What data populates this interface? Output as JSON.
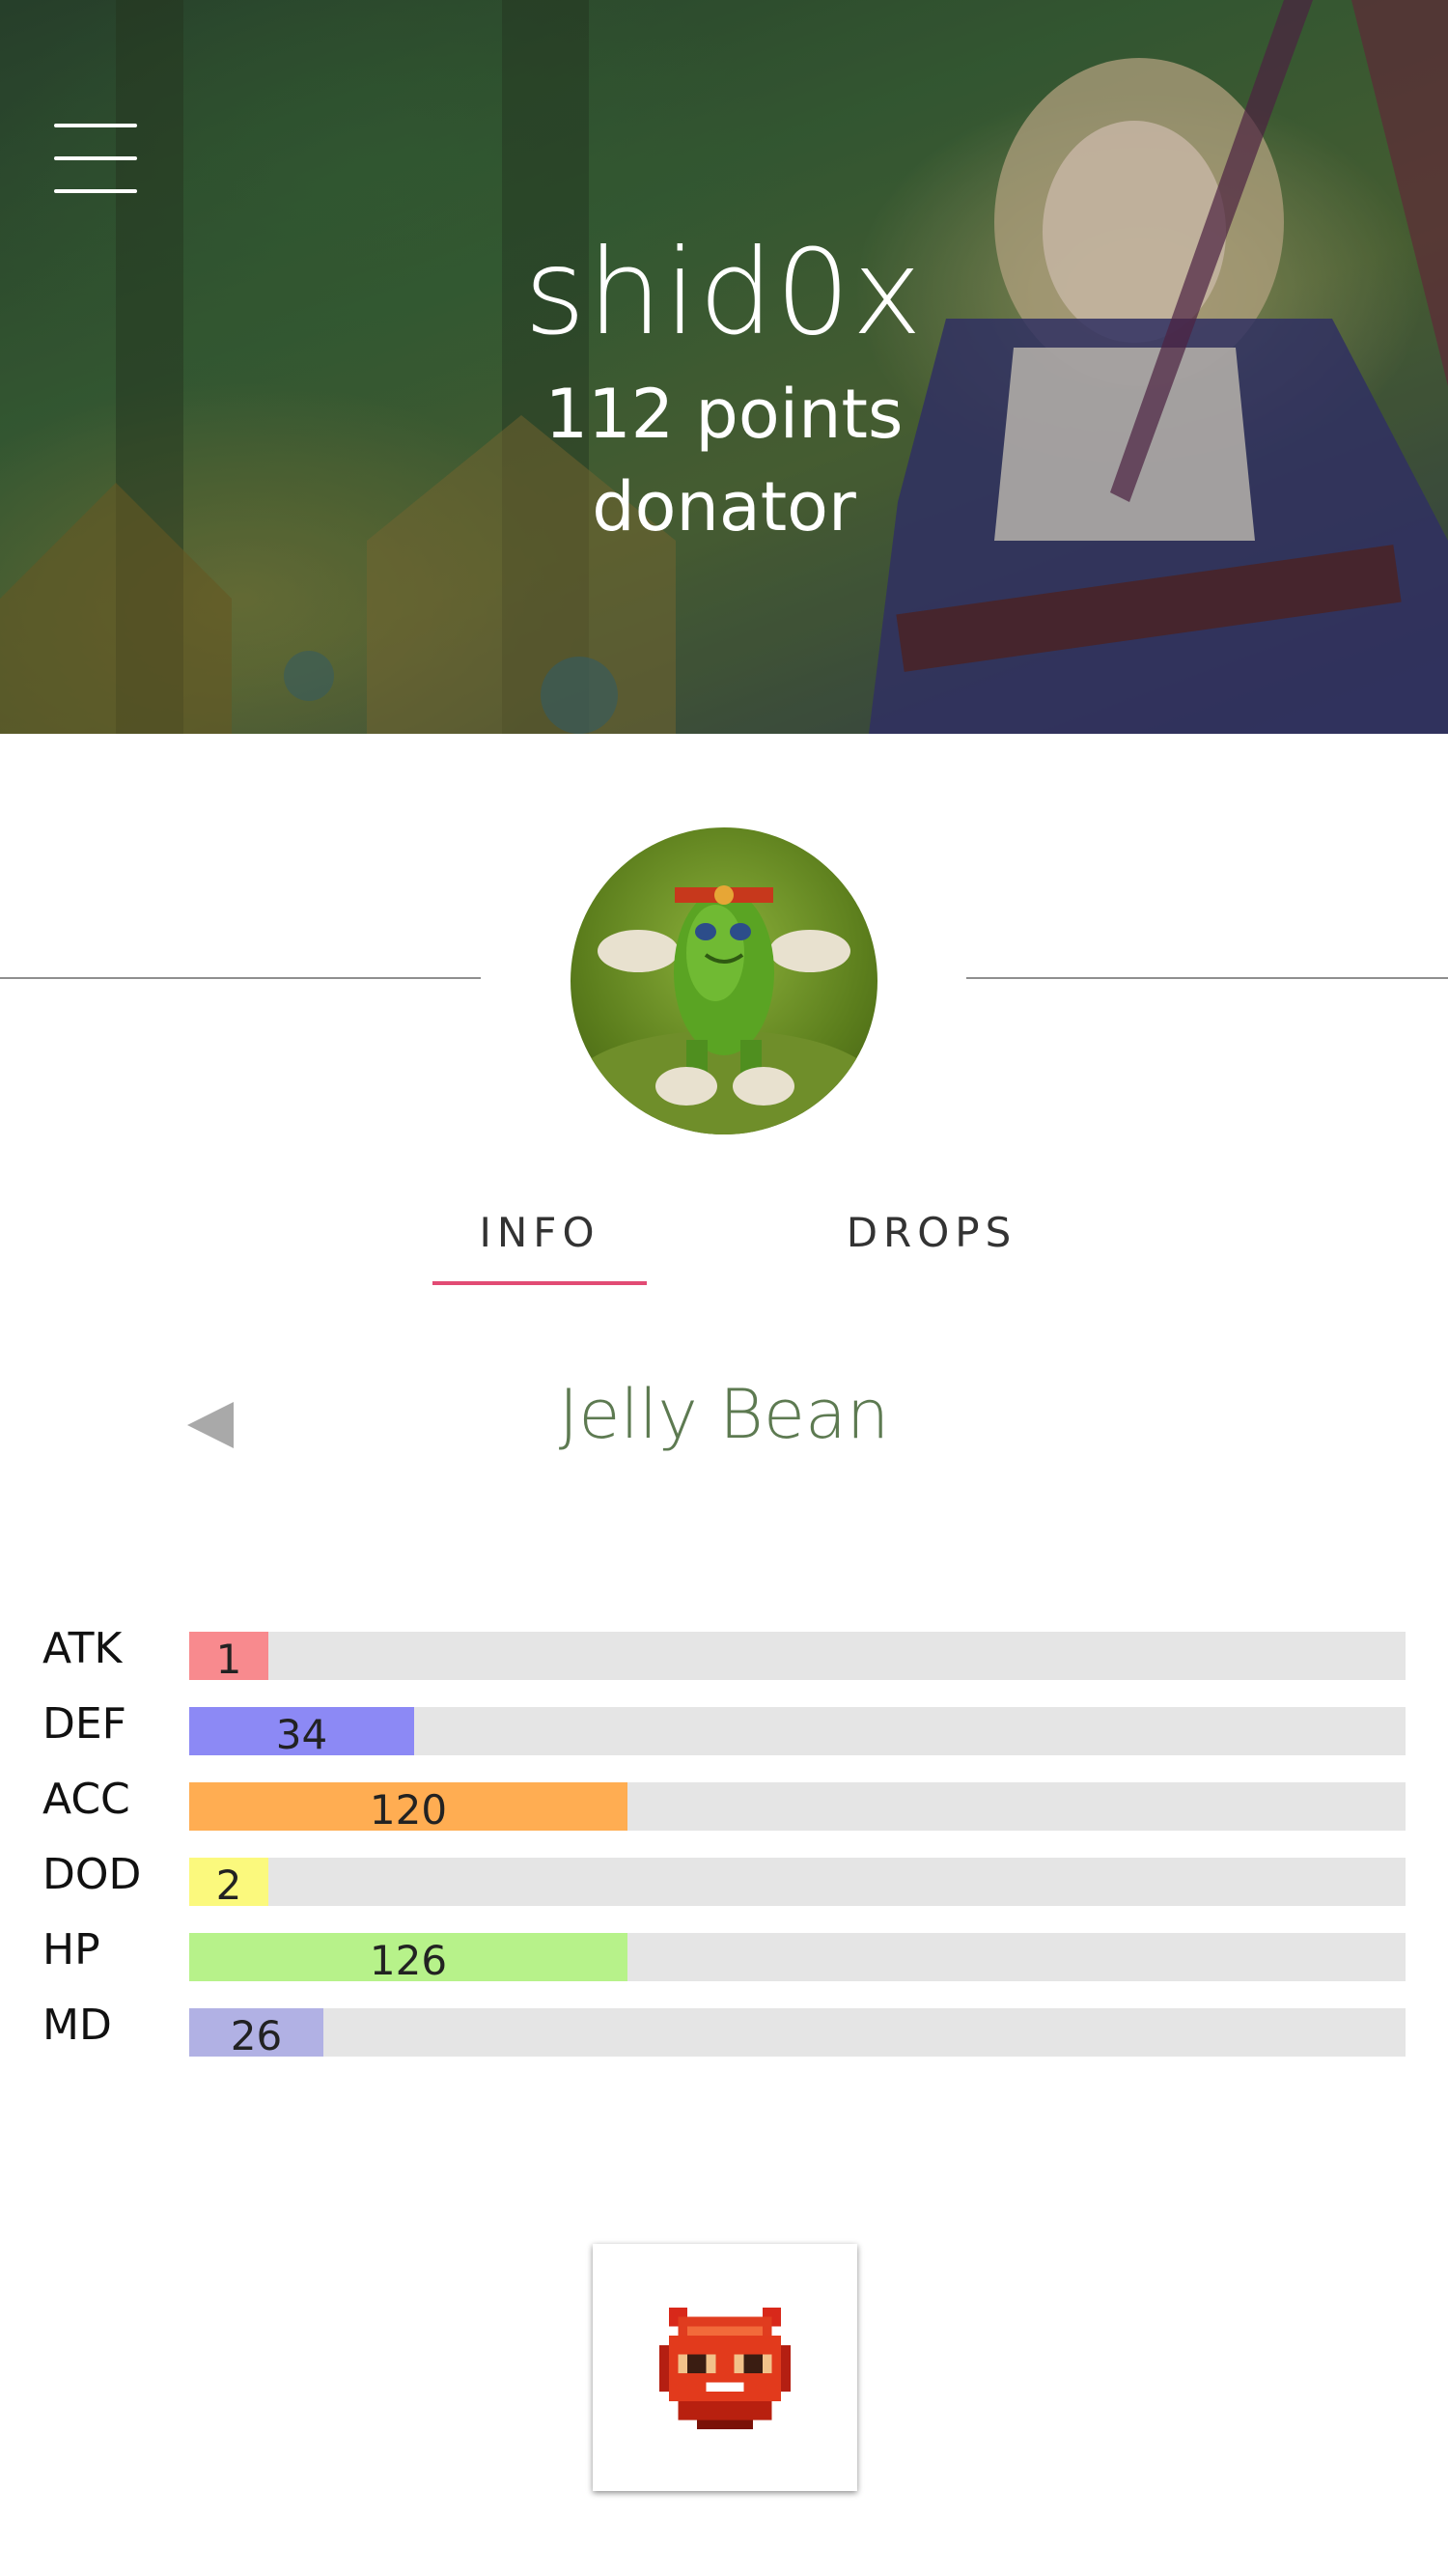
{
  "profile": {
    "username": "shid0x",
    "points": "112 points",
    "rank": "donator"
  },
  "tabs": [
    {
      "label": "INFO",
      "active": true
    },
    {
      "label": "DROPS",
      "active": false
    }
  ],
  "monster": {
    "name": "Jelly Bean"
  },
  "stats": [
    {
      "label": "ATK",
      "value": "1",
      "fill_fraction": 0.065,
      "color": "#f88a8e"
    },
    {
      "label": "DEF",
      "value": "34",
      "fill_fraction": 0.185,
      "color": "#8c89f5"
    },
    {
      "label": "ACC",
      "value": "120",
      "fill_fraction": 0.36,
      "color": "#ffad52"
    },
    {
      "label": "DOD",
      "value": "2",
      "fill_fraction": 0.065,
      "color": "#fbf97d"
    },
    {
      "label": "HP",
      "value": "126",
      "fill_fraction": 0.36,
      "color": "#b7f28a"
    },
    {
      "label": "MD",
      "value": "26",
      "fill_fraction": 0.11,
      "color": "#b1b1e4"
    }
  ],
  "colors": {
    "accent_underline": "#e24b74",
    "monster_name": "#5d7a51"
  },
  "icons": {
    "menu": "hamburger-menu-icon",
    "prev": "triangle-left-icon",
    "drop_item": "red-demon-mask-icon"
  }
}
